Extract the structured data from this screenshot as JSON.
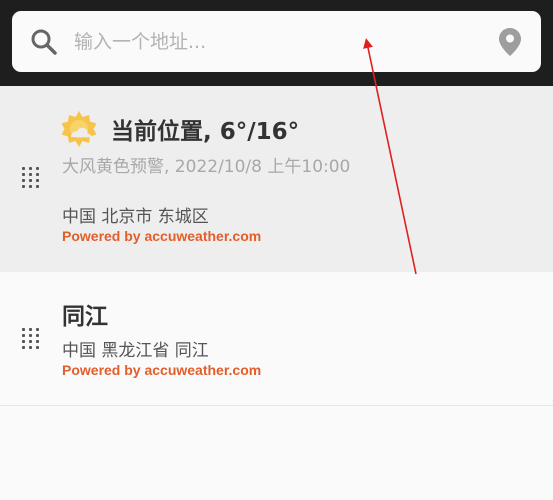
{
  "search": {
    "placeholder": "输入一个地址...",
    "icon": "search-icon",
    "location_icon": "location-pin-icon"
  },
  "locations": [
    {
      "title": "当前位置, 6°/16°",
      "alert": "大风黄色预警, 2022/10/8 上午10:00",
      "address": "中国 北京市 东城区",
      "powered_by": "Powered by accuweather.com",
      "weather_icon": "sunny-cloudy-icon",
      "selected": true
    },
    {
      "title": "同江",
      "address": "中国 黑龙江省 同江",
      "powered_by": "Powered by accuweather.com"
    }
  ],
  "colors": {
    "topbar": "#1e1e1e",
    "accent": "#e25e2a",
    "selected_bg": "#eeeeee",
    "annotation_arrow": "#e02020"
  }
}
